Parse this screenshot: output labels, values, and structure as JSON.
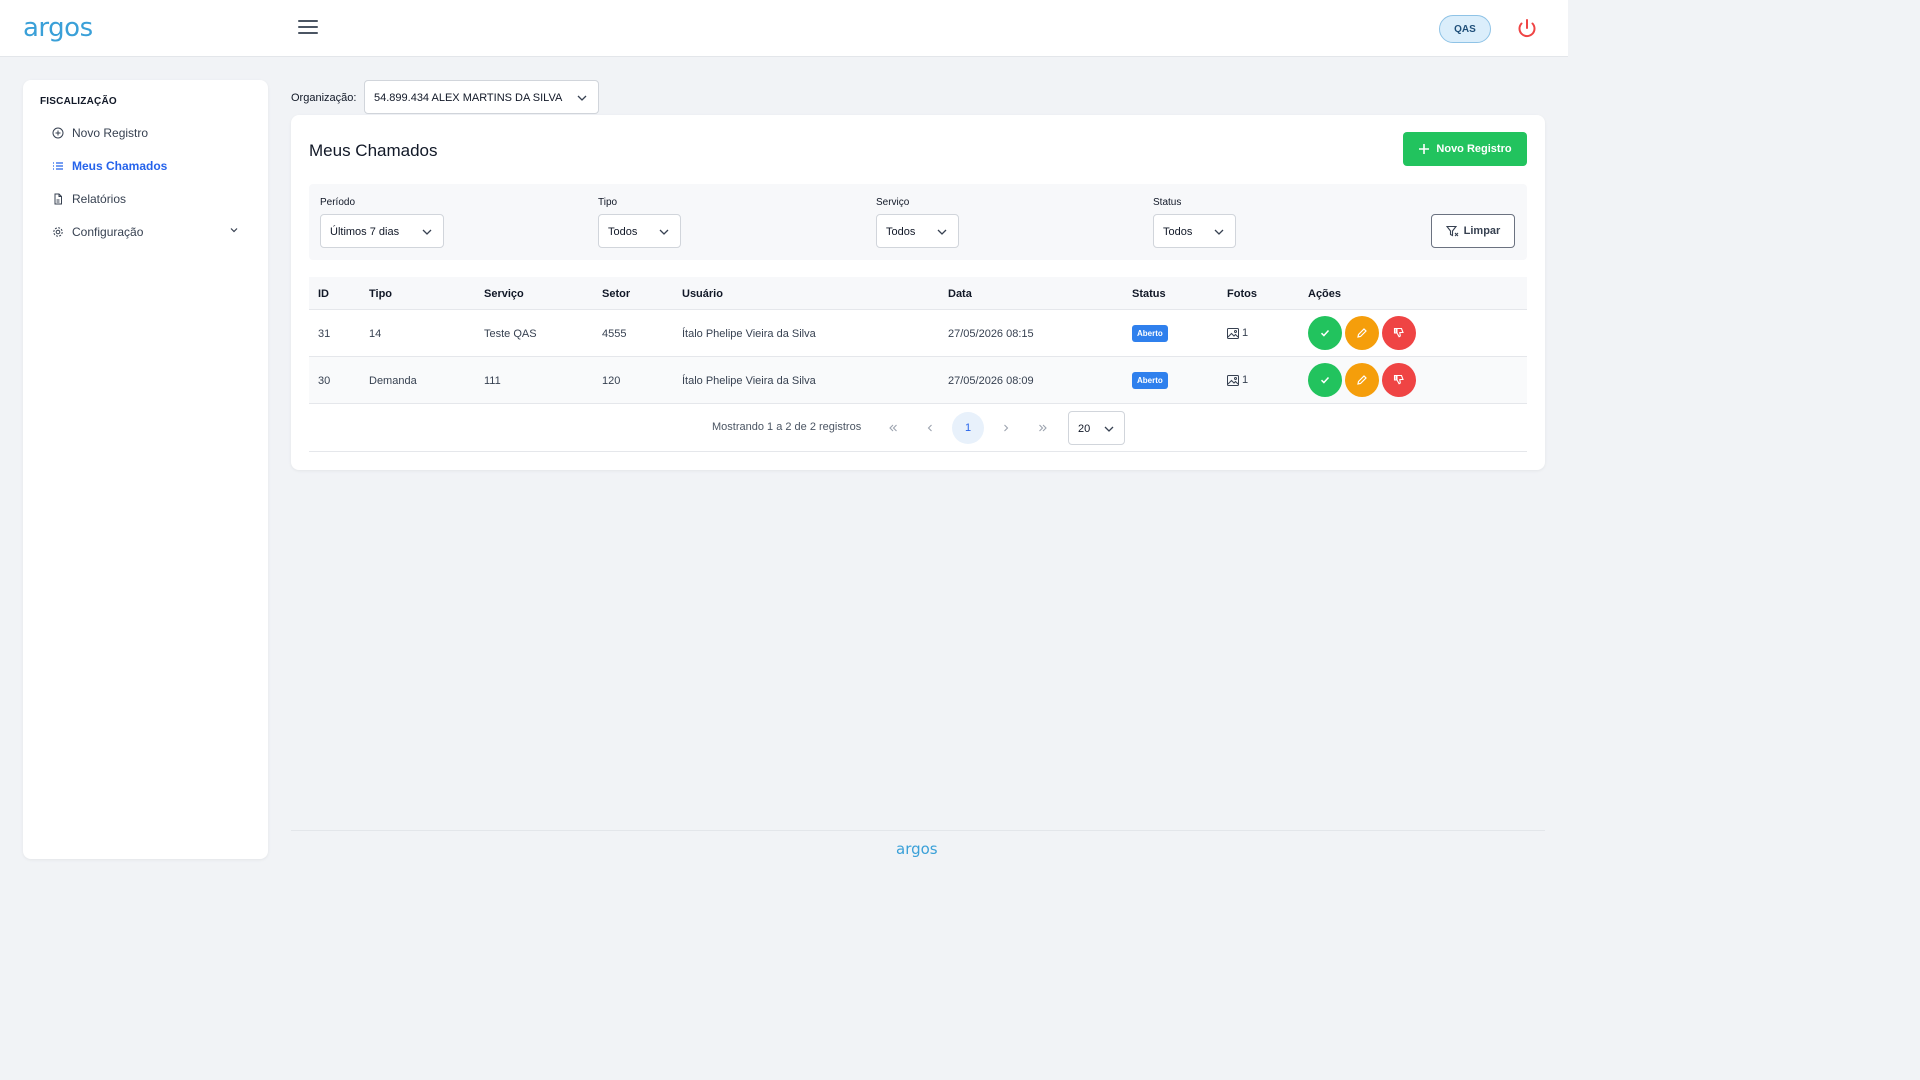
{
  "header": {
    "logo": "argos",
    "env_badge": "QAS"
  },
  "sidebar": {
    "section": "FISCALIZAÇÃO",
    "items": [
      {
        "label": "Novo Registro",
        "icon": "plus-circle-icon"
      },
      {
        "label": "Meus Chamados",
        "icon": "list-icon",
        "active": true
      },
      {
        "label": "Relatórios",
        "icon": "file-icon"
      },
      {
        "label": "Configuração",
        "icon": "gear-icon"
      }
    ]
  },
  "organization": {
    "label": "Organização:",
    "value": "54.899.434 ALEX MARTINS DA SILVA"
  },
  "main": {
    "title": "Meus Chamados",
    "new_button": "Novo Registro",
    "filters": {
      "periodo": {
        "label": "Período",
        "value": "Últimos 7 dias"
      },
      "tipo": {
        "label": "Tipo",
        "value": "Todos"
      },
      "servico": {
        "label": "Serviço",
        "value": "Todos"
      },
      "status": {
        "label": "Status",
        "value": "Todos"
      },
      "clear_button": "Limpar"
    },
    "table": {
      "columns": [
        "ID",
        "Tipo",
        "Serviço",
        "Setor",
        "Usuário",
        "Data",
        "Status",
        "Fotos",
        "Ações"
      ],
      "rows": [
        {
          "id": "31",
          "tipo": "14",
          "servico": "Teste QAS",
          "setor": "4555",
          "usuario": "Ítalo Phelipe Vieira da Silva",
          "data": "27/05/2026 08:15",
          "status": "Aberto",
          "fotos": "1"
        },
        {
          "id": "30",
          "tipo": "Demanda",
          "servico": "111",
          "setor": "120",
          "usuario": "Ítalo Phelipe Vieira da Silva",
          "data": "27/05/2026 08:09",
          "status": "Aberto",
          "fotos": "1"
        }
      ]
    },
    "pagination": {
      "info": "Mostrando 1 a 2 de 2 registros",
      "current_page": "1",
      "page_size": "20"
    }
  },
  "footer": {
    "logo": "argos"
  },
  "colors": {
    "primary": "#2563eb",
    "success": "#22c35e",
    "warning": "#f59e0b",
    "danger": "#ef4444",
    "status_open": "#2f80ed"
  }
}
